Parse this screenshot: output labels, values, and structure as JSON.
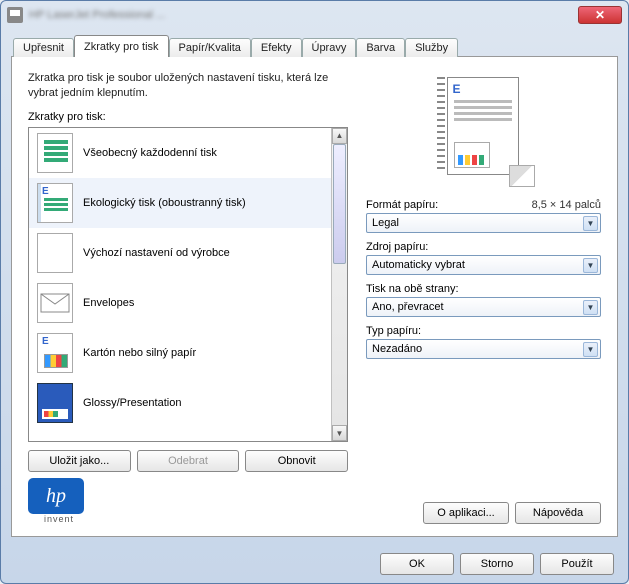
{
  "titlebar": {
    "title_blurred": "HP LaserJet Professional ..."
  },
  "tabs": [
    {
      "label": "Upřesnit"
    },
    {
      "label": "Zkratky pro tisk"
    },
    {
      "label": "Papír/Kvalita"
    },
    {
      "label": "Efekty"
    },
    {
      "label": "Úpravy"
    },
    {
      "label": "Barva"
    },
    {
      "label": "Služby"
    }
  ],
  "active_tab_index": 1,
  "intro_text": "Zkratka pro tisk je soubor uložených nastavení tisku, která lze vybrat jedním klepnutím.",
  "shortcuts": {
    "label": "Zkratky pro tisk:",
    "selected_index": 1,
    "items": [
      {
        "label": "Všeobecný každodenní tisk",
        "icon": "general"
      },
      {
        "label": "Ekologický tisk (oboustranný tisk)",
        "icon": "eco"
      },
      {
        "label": "Výchozí nastavení od výrobce",
        "icon": "blank"
      },
      {
        "label": "Envelopes",
        "icon": "envelope"
      },
      {
        "label": "Kartón nebo silný papír",
        "icon": "card"
      },
      {
        "label": "Glossy/Presentation",
        "icon": "glossy"
      }
    ]
  },
  "list_buttons": {
    "save_as": "Uložit jako...",
    "delete": "Odebrat",
    "reset": "Obnovit"
  },
  "settings": {
    "paper_size": {
      "label": "Formát papíru:",
      "hint": "8,5 × 14 palců",
      "value": "Legal"
    },
    "paper_source": {
      "label": "Zdroj papíru:",
      "value": "Automaticky vybrat"
    },
    "duplex": {
      "label": "Tisk na obě strany:",
      "value": "Ano, převracet"
    },
    "paper_type": {
      "label": "Typ papíru:",
      "value": "Nezadáno"
    }
  },
  "bottom_buttons": {
    "about": "O aplikaci...",
    "help": "Nápověda"
  },
  "logo": {
    "brand": "hp",
    "sub": "invent"
  },
  "footer": {
    "ok": "OK",
    "cancel": "Storno",
    "apply": "Použít"
  }
}
